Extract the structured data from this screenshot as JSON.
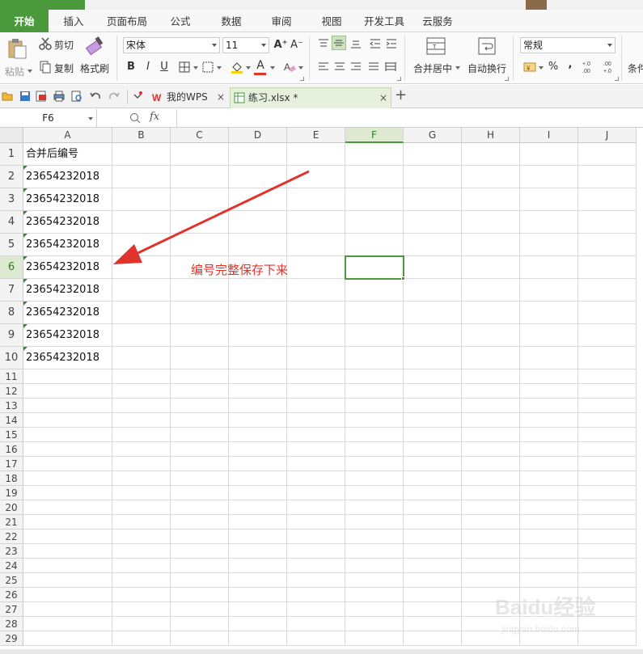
{
  "ribbon": {
    "tabs": [
      "开始",
      "插入",
      "页面布局",
      "公式",
      "数据",
      "审阅",
      "视图",
      "开发工具",
      "云服务"
    ],
    "active_tab": "开始",
    "clipboard": {
      "paste": "粘贴",
      "cut": "剪切",
      "copy": "复制",
      "format_painter": "格式刷"
    },
    "font": {
      "name": "宋体",
      "size": "11"
    },
    "merge_center": "合并居中",
    "wrap_text": "自动换行",
    "number_format": "常规",
    "conditional_partial": "条件"
  },
  "quick_access": {
    "doc_tabs": [
      {
        "label": "我的WPS",
        "active": false
      },
      {
        "label": "练习.xlsx *",
        "active": true
      }
    ]
  },
  "formula_bar": {
    "name_box": "F6",
    "fx": "fx",
    "value": ""
  },
  "sheet": {
    "columns": [
      "A",
      "B",
      "C",
      "D",
      "E",
      "F",
      "G",
      "H",
      "I",
      "J"
    ],
    "selected_column": "F",
    "selected_row": 6,
    "rows": [
      "1",
      "2",
      "3",
      "4",
      "5",
      "6",
      "7",
      "8",
      "9",
      "10",
      "11",
      "12",
      "13",
      "14",
      "15",
      "16",
      "17",
      "18",
      "19",
      "20",
      "21",
      "22",
      "23",
      "24",
      "25",
      "26",
      "27",
      "28",
      "29"
    ],
    "a_values": [
      "合并后编号",
      "23654232018",
      "23654232018",
      "23654232018",
      "23654232018",
      "23654232018",
      "23654232018",
      "23654232018",
      "23654232018",
      "23654232018"
    ]
  },
  "annotation": {
    "text": "编号完整保存下来",
    "color": "#e0332c"
  },
  "colors": {
    "accent": "#4a9a3c"
  },
  "watermark": {
    "text": "Baidu经验",
    "subtext": "jingyan.baidu.com"
  }
}
